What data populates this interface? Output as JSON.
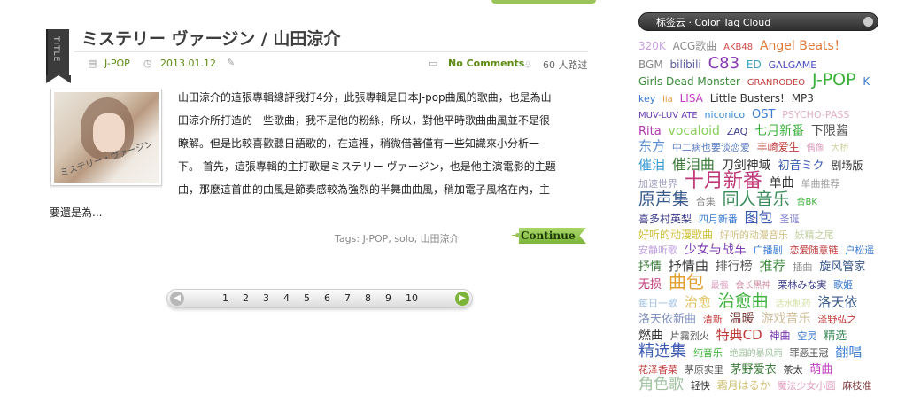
{
  "post": {
    "ribbon_label": "TITLE",
    "title": "ミステリー ヴァージン / 山田涼介",
    "category": "J-POP",
    "date": "2013.01.12",
    "comments": "No Comments",
    "views": "60 人路过",
    "cover_text": "ミステリー・ヴァージン",
    "excerpt_lines": [
      "山田涼介的這張專輯總評我打4分，此張專輯是日本J-pop曲風的歌曲，也是為山",
      "田涼介所打造的一些歌曲，我不是他的粉絲，所以，對他平時歌曲曲風並不是很",
      "瞭解。但是比較喜歡聽日語歌的，在這裡，稍微借著僅有一些知識來小分析一",
      "下。 首先，這張專輯的主打歌是ミステリー ヴァージン，也是他主演電影的主題",
      "曲，那麼這首曲的曲風是節奏感較為強烈的半舞曲曲風，稍加電子風格在內，主"
    ],
    "excerpt_last": "要還是為...",
    "tags_label": "Tags:",
    "tags": [
      "J-POP",
      "solo",
      "山田涼介"
    ],
    "continue_label": "Continue"
  },
  "pagination": {
    "prev_icon": "chevron-left-icon",
    "next_icon": "chevron-right-icon",
    "pages": [
      "1",
      "2",
      "3",
      "4",
      "5",
      "6",
      "7",
      "8",
      "9",
      "10"
    ]
  },
  "sidebar": {
    "cloud_title": "标签云 · Color Tag Cloud",
    "tags": [
      {
        "text": "320K",
        "color": "#c9a0dc",
        "size": 12
      },
      {
        "text": "ACG歌曲",
        "color": "#8a8a8a",
        "size": 12
      },
      {
        "text": "AKB48",
        "color": "#d04a4a",
        "size": 10
      },
      {
        "text": "Angel Beats！",
        "color": "#e07a3a",
        "size": 14
      },
      {
        "text": "BGM",
        "color": "#888888",
        "size": 12
      },
      {
        "text": "bilibili",
        "color": "#5a5aa0",
        "size": 12
      },
      {
        "text": "C83",
        "color": "#8a3ab0",
        "size": 18
      },
      {
        "text": "ED",
        "color": "#3aa0c0",
        "size": 12
      },
      {
        "text": "GALGAME",
        "color": "#4a4ac0",
        "size": 11
      },
      {
        "text": "Girls Dead Monster",
        "color": "#3a8a3a",
        "size": 12
      },
      {
        "text": "GRANRODEO",
        "color": "#c03a3a",
        "size": 10
      },
      {
        "text": "J-POP",
        "color": "#3ab03a",
        "size": 19
      },
      {
        "text": "K",
        "color": "#3a7ad0",
        "size": 12
      },
      {
        "text": "key",
        "color": "#3a7ad0",
        "size": 11
      },
      {
        "text": "lia",
        "color": "#e09a3a",
        "size": 10
      },
      {
        "text": "LISA",
        "color": "#c03ac0",
        "size": 12
      },
      {
        "text": "Little Busters!",
        "color": "#333333",
        "size": 12
      },
      {
        "text": "MP3",
        "color": "#333333",
        "size": 12
      },
      {
        "text": "MUV-LUV ATE",
        "color": "#6a3ab0",
        "size": 10
      },
      {
        "text": "niconico",
        "color": "#3a8ad0",
        "size": 11
      },
      {
        "text": "OST",
        "color": "#3a7ad0",
        "size": 13
      },
      {
        "text": "PSYCHO-PASS",
        "color": "#e0b0c0",
        "size": 11
      },
      {
        "text": "Rita",
        "color": "#b03ab0",
        "size": 13
      },
      {
        "text": "vocaloid",
        "color": "#8ad05a",
        "size": 14
      },
      {
        "text": "ZAQ",
        "color": "#3a3a8a",
        "size": 11
      },
      {
        "text": "七月新番",
        "color": "#3ab03a",
        "size": 14
      },
      {
        "text": "下限酱",
        "color": "#555555",
        "size": 14
      },
      {
        "text": "东方",
        "color": "#5a8ad0",
        "size": 15
      },
      {
        "text": "中二病也要谈恋爱",
        "color": "#5a7ac0",
        "size": 11
      },
      {
        "text": "丰崎爱生",
        "color": "#c03a3a",
        "size": 12
      },
      {
        "text": "偶像",
        "color": "#e0a0c0",
        "size": 10
      },
      {
        "text": "大桥",
        "color": "#d0d0a0",
        "size": 10
      },
      {
        "text": "催泪",
        "color": "#3a9ad0",
        "size": 15
      },
      {
        "text": "催泪曲",
        "color": "#3a7a3a",
        "size": 16
      },
      {
        "text": "刀剑神域",
        "color": "#333333",
        "size": 14
      },
      {
        "text": "初音ミク",
        "color": "#3a5ab0",
        "size": 13
      },
      {
        "text": "剧场版",
        "color": "#333333",
        "size": 12
      },
      {
        "text": "加速世界",
        "color": "#a0a0c0",
        "size": 11
      },
      {
        "text": "十月新番",
        "color": "#c03a7a",
        "size": 22
      },
      {
        "text": "单曲",
        "color": "#333333",
        "size": 14
      },
      {
        "text": "单曲推荐",
        "color": "#a0a0a0",
        "size": 11
      },
      {
        "text": "原声集",
        "color": "#3a5a8a",
        "size": 19
      },
      {
        "text": "合集",
        "color": "#888888",
        "size": 11
      },
      {
        "text": "同人音乐",
        "color": "#3a8a5a",
        "size": 19
      },
      {
        "text": "合BK",
        "color": "#3ab03a",
        "size": 10
      },
      {
        "text": "喜多村英梨",
        "color": "#3a3a8a",
        "size": 12
      },
      {
        "text": "四月新番",
        "color": "#3a7ad0",
        "size": 11
      },
      {
        "text": "图包",
        "color": "#3a5ab0",
        "size": 16
      },
      {
        "text": "圣诞",
        "color": "#7a7ad0",
        "size": 11
      },
      {
        "text": "好听的动漫歌曲",
        "color": "#d0c03a",
        "size": 12
      },
      {
        "text": "好听的动漫音乐",
        "color": "#d0c080",
        "size": 11
      },
      {
        "text": "妖精之尾",
        "color": "#c0d0a0",
        "size": 11
      },
      {
        "text": "安静听歌",
        "color": "#c0a0e0",
        "size": 11
      },
      {
        "text": "少女与战车",
        "color": "#7a3ab0",
        "size": 14
      },
      {
        "text": "广播剧",
        "color": "#3a7ad0",
        "size": 11
      },
      {
        "text": "恋爱随意链",
        "color": "#c03a3a",
        "size": 11
      },
      {
        "text": "户松遥",
        "color": "#3a7ad0",
        "size": 11
      },
      {
        "text": "抒情",
        "color": "#3a7a3a",
        "size": 13
      },
      {
        "text": "抒情曲",
        "color": "#3a3a3a",
        "size": 15
      },
      {
        "text": "排行榜",
        "color": "#555555",
        "size": 14
      },
      {
        "text": "推荐",
        "color": "#3a8a3a",
        "size": 15
      },
      {
        "text": "插曲",
        "color": "#888888",
        "size": 11
      },
      {
        "text": "旋风管家",
        "color": "#3a5a8a",
        "size": 13
      },
      {
        "text": "无损",
        "color": "#c03a7a",
        "size": 13
      },
      {
        "text": "曲包",
        "color": "#e0a030",
        "size": 20
      },
      {
        "text": "最强",
        "color": "#e0a0c0",
        "size": 10
      },
      {
        "text": "会长黑神",
        "color": "#d090a0",
        "size": 10
      },
      {
        "text": "栗林みな実",
        "color": "#3a3a8a",
        "size": 11
      },
      {
        "text": "歌姬",
        "color": "#3a7ad0",
        "size": 11
      },
      {
        "text": "每日一歌",
        "color": "#a0c0e0",
        "size": 11
      },
      {
        "text": "治愈",
        "color": "#e0c060",
        "size": 15
      },
      {
        "text": "治愈曲",
        "color": "#3ab03a",
        "size": 19
      },
      {
        "text": "活水制药",
        "color": "#d0e0a0",
        "size": 10
      },
      {
        "text": "洛天依",
        "color": "#3a5a8a",
        "size": 15
      },
      {
        "text": "洛天依新曲",
        "color": "#8090c0",
        "size": 13
      },
      {
        "text": "清新",
        "color": "#c03a3a",
        "size": 11
      },
      {
        "text": "温暖",
        "color": "#7a3a3a",
        "size": 14
      },
      {
        "text": "游戏音乐",
        "color": "#d0c0a0",
        "size": 14
      },
      {
        "text": "泽野弘之",
        "color": "#c03a3a",
        "size": 11
      },
      {
        "text": "燃曲",
        "color": "#333333",
        "size": 14
      },
      {
        "text": "片霧烈火",
        "color": "#555555",
        "size": 11
      },
      {
        "text": "特典CD",
        "color": "#c03a3a",
        "size": 15
      },
      {
        "text": "神曲",
        "color": "#7a3ab0",
        "size": 12
      },
      {
        "text": "空灵",
        "color": "#3a7ad0",
        "size": 11
      },
      {
        "text": "精选",
        "color": "#3a8a5a",
        "size": 13
      },
      {
        "text": "精选集",
        "color": "#3a5ab0",
        "size": 18
      },
      {
        "text": "纯音乐",
        "color": "#3ab03a",
        "size": 11
      },
      {
        "text": "绝园的暴风雨",
        "color": "#a0c0a0",
        "size": 10
      },
      {
        "text": "罪恶王冠",
        "color": "#555555",
        "size": 11
      },
      {
        "text": "翻唱",
        "color": "#3a7ad0",
        "size": 15
      },
      {
        "text": "花泽香菜",
        "color": "#c03a3a",
        "size": 11
      },
      {
        "text": "茅原实里",
        "color": "#555555",
        "size": 11
      },
      {
        "text": "茅野爱衣",
        "color": "#3a7a3a",
        "size": 13
      },
      {
        "text": "茶太",
        "color": "#333333",
        "size": 11
      },
      {
        "text": "萌曲",
        "color": "#c03ac0",
        "size": 13
      },
      {
        "text": "角色歌",
        "color": "#a0c0a0",
        "size": 17
      },
      {
        "text": "轻快",
        "color": "#333333",
        "size": 11
      },
      {
        "text": "霜月はるか",
        "color": "#d0c070",
        "size": 12
      },
      {
        "text": "魔法少女小圆",
        "color": "#e0a0c0",
        "size": 11
      },
      {
        "text": "麻枝准",
        "color": "#7a3a3a",
        "size": 11
      }
    ]
  }
}
